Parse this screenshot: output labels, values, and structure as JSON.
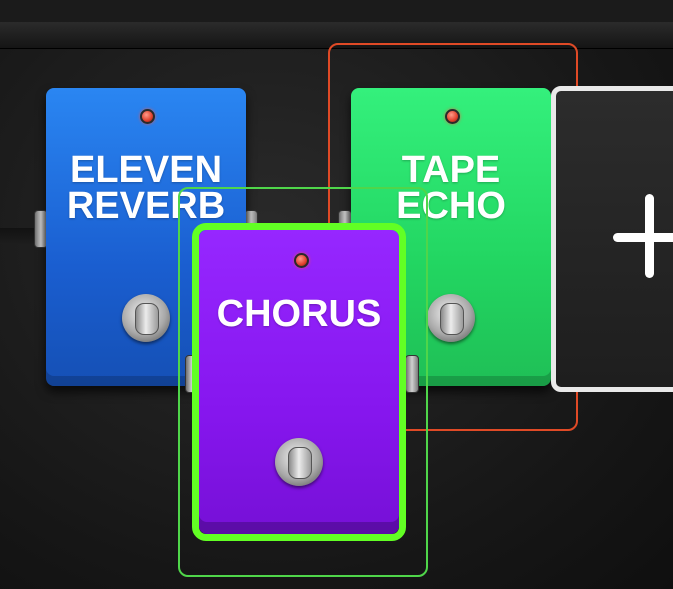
{
  "pedalboard": {
    "pedals": [
      {
        "name": "ELEVEN\nREVERB",
        "color": "#1f6fe0",
        "state": "inactive"
      },
      {
        "name": "TAPE\nECHO",
        "color": "#27e26a",
        "state": "inactive"
      },
      {
        "name": "CHORUS",
        "color": "#8a17f0",
        "state": "selected"
      }
    ],
    "selection_colors": {
      "chorus_outline": "#4fd64a",
      "chorus_border": "#62ff24",
      "tape_echo_outline": "#e04a26"
    },
    "add_slot": {
      "icon": "plus-icon",
      "border_color": "#e9e9e9"
    }
  }
}
